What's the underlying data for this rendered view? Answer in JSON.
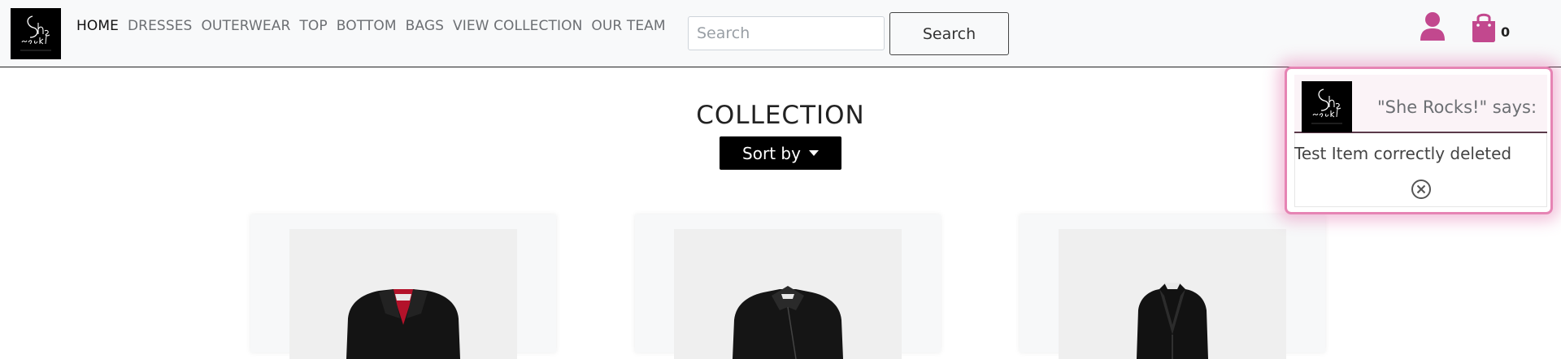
{
  "header": {
    "logo_text": "She rocks!",
    "nav": [
      {
        "label": "HOME",
        "active": true
      },
      {
        "label": "DRESSES",
        "active": false
      },
      {
        "label": "OUTERWEAR",
        "active": false
      },
      {
        "label": "TOP",
        "active": false
      },
      {
        "label": "BOTTOM",
        "active": false
      },
      {
        "label": "BAGS",
        "active": false
      },
      {
        "label": "VIEW COLLECTION",
        "active": false
      },
      {
        "label": "OUR TEAM",
        "active": false
      }
    ],
    "search": {
      "placeholder": "Search",
      "value": "",
      "button_label": "Search"
    },
    "user_icon": "user-icon",
    "cart_icon": "shopping-bag-icon",
    "cart_count": "0",
    "accent_color": "#c2488e"
  },
  "main": {
    "title": "COLLECTION",
    "sort_label": "Sort by",
    "products": [
      {
        "image": "black leather biker jacket with red lining"
      },
      {
        "image": "black leather biker jacket"
      },
      {
        "image": "black leather fitted blazer coat"
      }
    ]
  },
  "toast": {
    "title": "\"She Rocks!\" says:",
    "message": "Test Item correctly deleted",
    "close_icon": "close-circle-icon",
    "border_color": "#e684b4"
  }
}
